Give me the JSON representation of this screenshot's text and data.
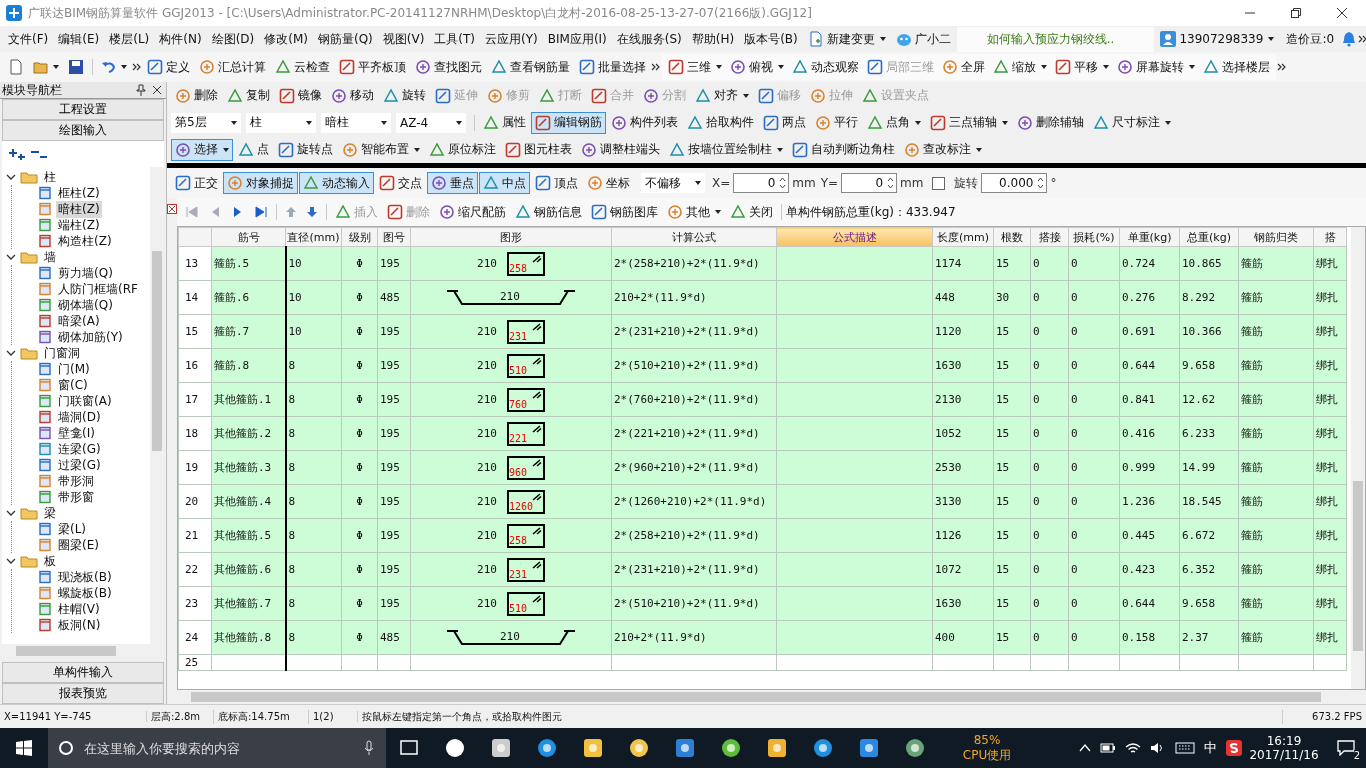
{
  "title_bar": {
    "title": "广联达BIM钢筋算量软件 GGJ2013 - [C:\\Users\\Administrator.PC-20141127NRHM\\Desktop\\白龙村-2016-08-25-13-27-07(2166版).GGJ12]"
  },
  "menu_bar": {
    "menus": [
      "文件(F)",
      "编辑(E)",
      "楼层(L)",
      "构件(N)",
      "绘图(D)",
      "修改(M)",
      "钢筋量(Q)",
      "视图(V)",
      "工具(T)",
      "云应用(Y)",
      "BIM应用(I)",
      "在线服务(S)",
      "帮助(H)",
      "版本号(B)"
    ],
    "new_change": "新建变更",
    "assistant": "广小二",
    "tip": "如何输入预应力钢绞线..",
    "account": "13907298339",
    "beans": "造价豆:0"
  },
  "main_toolbar": [
    {
      "label": "定义",
      "dropdown": false,
      "disabled": false
    },
    {
      "label": "汇总计算",
      "dropdown": false,
      "disabled": false
    },
    {
      "label": "云检查",
      "dropdown": false,
      "disabled": false
    },
    {
      "label": "平齐板顶",
      "dropdown": false,
      "disabled": false
    },
    {
      "label": "查找图元",
      "dropdown": false,
      "disabled": false
    },
    {
      "label": "查看钢筋量",
      "dropdown": false,
      "disabled": false
    },
    {
      "label": "批量选择",
      "dropdown": false,
      "disabled": false
    }
  ],
  "view_toolbar": [
    {
      "label": "三维",
      "dropdown": true,
      "disabled": false
    },
    {
      "label": "俯视",
      "dropdown": true,
      "disabled": false
    },
    {
      "label": "动态观察",
      "dropdown": false,
      "disabled": false
    },
    {
      "label": "局部三维",
      "dropdown": false,
      "disabled": true
    },
    {
      "label": "全屏",
      "dropdown": false,
      "disabled": false
    },
    {
      "label": "缩放",
      "dropdown": true,
      "disabled": false
    },
    {
      "label": "平移",
      "dropdown": true,
      "disabled": false
    },
    {
      "label": "屏幕旋转",
      "dropdown": true,
      "disabled": false
    },
    {
      "label": "选择楼层",
      "dropdown": false,
      "disabled": false
    }
  ],
  "navigator": {
    "title": "模块导航栏",
    "buttons": [
      "工程设置",
      "绘图输入"
    ],
    "bottom_buttons": [
      "单构件输入",
      "报表预览"
    ]
  },
  "tree": [
    {
      "label": "柱",
      "expanded": true,
      "selected": false,
      "children": [
        {
          "label": "框柱(Z)",
          "selected": false
        },
        {
          "label": "暗柱(Z)",
          "selected": true
        },
        {
          "label": "端柱(Z)",
          "selected": false
        },
        {
          "label": "构造柱(Z)",
          "selected": false
        }
      ]
    },
    {
      "label": "墙",
      "expanded": true,
      "selected": false,
      "children": [
        {
          "label": "剪力墙(Q)",
          "selected": false
        },
        {
          "label": "人防门框墙(RF",
          "selected": false
        },
        {
          "label": "砌体墙(Q)",
          "selected": false
        },
        {
          "label": "暗梁(A)",
          "selected": false
        },
        {
          "label": "砌体加筋(Y)",
          "selected": false
        }
      ]
    },
    {
      "label": "门窗洞",
      "expanded": true,
      "selected": false,
      "children": [
        {
          "label": "门(M)",
          "selected": false
        },
        {
          "label": "窗(C)",
          "selected": false
        },
        {
          "label": "门联窗(A)",
          "selected": false
        },
        {
          "label": "墙洞(D)",
          "selected": false
        },
        {
          "label": "壁龛(I)",
          "selected": false
        },
        {
          "label": "连梁(G)",
          "selected": false
        },
        {
          "label": "过梁(G)",
          "selected": false
        },
        {
          "label": "带形洞",
          "selected": false
        },
        {
          "label": "带形窗",
          "selected": false
        }
      ]
    },
    {
      "label": "梁",
      "expanded": true,
      "selected": false,
      "children": [
        {
          "label": "梁(L)",
          "selected": false
        },
        {
          "label": "圈梁(E)",
          "selected": false
        }
      ]
    },
    {
      "label": "板",
      "expanded": true,
      "selected": false,
      "children": [
        {
          "label": "现浇板(B)",
          "selected": false
        },
        {
          "label": "螺旋板(B)",
          "selected": false
        },
        {
          "label": "柱帽(V)",
          "selected": false
        },
        {
          "label": "板洞(N)",
          "selected": false
        }
      ]
    }
  ],
  "edit_toolbar": [
    {
      "label": "删除",
      "dropdown": false,
      "disabled": false
    },
    {
      "label": "复制",
      "dropdown": false,
      "disabled": false
    },
    {
      "label": "镜像",
      "dropdown": false,
      "disabled": false
    },
    {
      "label": "移动",
      "dropdown": false,
      "disabled": false
    },
    {
      "label": "旋转",
      "dropdown": false,
      "disabled": false
    },
    {
      "label": "延伸",
      "dropdown": false,
      "disabled": true
    },
    {
      "label": "修剪",
      "dropdown": false,
      "disabled": true
    },
    {
      "label": "打断",
      "dropdown": false,
      "disabled": true
    },
    {
      "label": "合并",
      "dropdown": false,
      "disabled": true
    },
    {
      "label": "分割",
      "dropdown": false,
      "disabled": true
    },
    {
      "label": "对齐",
      "dropdown": true,
      "disabled": false
    },
    {
      "label": "偏移",
      "dropdown": false,
      "disabled": true
    },
    {
      "label": "拉伸",
      "dropdown": false,
      "disabled": true
    },
    {
      "label": "设置夹点",
      "dropdown": false,
      "disabled": true
    }
  ],
  "component_bar": {
    "selectors": [
      "第5层",
      "柱",
      "暗柱",
      "AZ-4"
    ],
    "items": [
      {
        "label": "属性",
        "dropdown": false,
        "selected": false
      },
      {
        "label": "编辑钢筋",
        "dropdown": false,
        "selected": true
      },
      {
        "label": "构件列表",
        "dropdown": false,
        "selected": false
      },
      {
        "label": "拾取构件",
        "dropdown": false,
        "selected": false
      },
      {
        "label": "两点",
        "dropdown": false,
        "selected": false
      },
      {
        "label": "平行",
        "dropdown": false,
        "selected": false
      },
      {
        "label": "点角",
        "dropdown": true,
        "selected": false
      },
      {
        "label": "三点辅轴",
        "dropdown": true,
        "selected": false
      },
      {
        "label": "删除辅轴",
        "dropdown": false,
        "selected": false
      },
      {
        "label": "尺寸标注",
        "dropdown": true,
        "selected": false
      }
    ]
  },
  "draw_toolbar": [
    {
      "label": "选择",
      "dropdown": true,
      "selected": true
    },
    {
      "label": "点",
      "dropdown": false,
      "selected": false
    },
    {
      "label": "旋转点",
      "dropdown": false,
      "selected": false
    },
    {
      "label": "智能布置",
      "dropdown": true,
      "selected": false
    },
    {
      "label": "原位标注",
      "dropdown": false,
      "selected": false
    },
    {
      "label": "图元柱表",
      "dropdown": false,
      "selected": false
    },
    {
      "label": "调整柱端头",
      "dropdown": false,
      "selected": false
    },
    {
      "label": "按墙位置绘制柱",
      "dropdown": true,
      "selected": false
    },
    {
      "label": "自动判断边角柱",
      "dropdown": false,
      "selected": false
    },
    {
      "label": "查改标注",
      "dropdown": true,
      "selected": false
    }
  ],
  "snap_bar": {
    "items": [
      {
        "label": "正交",
        "selected": false
      },
      {
        "label": "对象捕捉",
        "selected": true
      },
      {
        "label": "动态输入",
        "selected": true
      },
      {
        "label": "交点",
        "selected": false
      },
      {
        "label": "垂点",
        "selected": true
      },
      {
        "label": "中点",
        "selected": true
      },
      {
        "label": "顶点",
        "selected": false
      },
      {
        "label": "坐标",
        "selected": false
      }
    ],
    "offset_mode": "不偏移",
    "x_label": "X=",
    "x_value": "0",
    "x_unit": "mm",
    "y_label": "Y=",
    "y_value": "0",
    "y_unit": "mm",
    "rotate_checked": false,
    "rotate_label": "旋转",
    "rotate_value": "0.000",
    "rotate_unit": "°"
  },
  "rebar_toolbar": {
    "items": [
      {
        "label": "插入",
        "dropdown": false,
        "disabled": true
      },
      {
        "label": "删除",
        "dropdown": false,
        "disabled": true
      },
      {
        "label": "缩尺配筋",
        "dropdown": false,
        "disabled": false
      },
      {
        "label": "钢筋信息",
        "dropdown": false,
        "disabled": false
      },
      {
        "label": "钢筋图库",
        "dropdown": false,
        "disabled": false
      },
      {
        "label": "其他",
        "dropdown": true,
        "disabled": false
      },
      {
        "label": "关闭",
        "dropdown": false,
        "disabled": false
      }
    ],
    "total": "单构件钢筋总重(kg)：433.947"
  },
  "table": {
    "columns": [
      "",
      "筋号",
      "直径(mm)",
      "级别",
      "图号",
      "图形",
      "计算公式",
      "公式描述",
      "长度(mm)",
      "根数",
      "搭接",
      "损耗(%)",
      "单重(kg)",
      "总重(kg)",
      "钢筋归类",
      "搭"
    ],
    "rows": [
      {
        "index": "13",
        "name": "箍筋.5",
        "diameter": "10",
        "grade": "Φ",
        "shape_no": "195",
        "shape": {
          "kind": "stirrup",
          "side": "210",
          "inner": "258"
        },
        "formula": "2*(258+210)+2*(11.9*d)",
        "length": "1174",
        "count": "15",
        "lap": "0",
        "loss": "0",
        "unit_weight": "0.724",
        "total_weight": "10.865",
        "category": "箍筋",
        "lap_type": "绑扎"
      },
      {
        "index": "14",
        "name": "箍筋.6",
        "diameter": "10",
        "grade": "Φ",
        "shape_no": "485",
        "shape": {
          "kind": "hooked-bar",
          "side": "210"
        },
        "formula": "210+2*(11.9*d)",
        "length": "448",
        "count": "30",
        "lap": "0",
        "loss": "0",
        "unit_weight": "0.276",
        "total_weight": "8.292",
        "category": "箍筋",
        "lap_type": "绑扎"
      },
      {
        "index": "15",
        "name": "箍筋.7",
        "diameter": "10",
        "grade": "Φ",
        "shape_no": "195",
        "shape": {
          "kind": "stirrup",
          "side": "210",
          "inner": "231"
        },
        "formula": "2*(231+210)+2*(11.9*d)",
        "length": "1120",
        "count": "15",
        "lap": "0",
        "loss": "0",
        "unit_weight": "0.691",
        "total_weight": "10.366",
        "category": "箍筋",
        "lap_type": "绑扎"
      },
      {
        "index": "16",
        "name": "箍筋.8",
        "diameter": "8",
        "grade": "Φ",
        "shape_no": "195",
        "shape": {
          "kind": "stirrup",
          "side": "210",
          "inner": "510"
        },
        "formula": "2*(510+210)+2*(11.9*d)",
        "length": "1630",
        "count": "15",
        "lap": "0",
        "loss": "0",
        "unit_weight": "0.644",
        "total_weight": "9.658",
        "category": "箍筋",
        "lap_type": "绑扎"
      },
      {
        "index": "17",
        "name": "其他箍筋.1",
        "diameter": "8",
        "grade": "Φ",
        "shape_no": "195",
        "shape": {
          "kind": "stirrup",
          "side": "210",
          "inner": "760"
        },
        "formula": "2*(760+210)+2*(11.9*d)",
        "length": "2130",
        "count": "15",
        "lap": "0",
        "loss": "0",
        "unit_weight": "0.841",
        "total_weight": "12.62",
        "category": "箍筋",
        "lap_type": "绑扎"
      },
      {
        "index": "18",
        "name": "其他箍筋.2",
        "diameter": "8",
        "grade": "Φ",
        "shape_no": "195",
        "shape": {
          "kind": "stirrup",
          "side": "210",
          "inner": "221"
        },
        "formula": "2*(221+210)+2*(11.9*d)",
        "length": "1052",
        "count": "15",
        "lap": "0",
        "loss": "0",
        "unit_weight": "0.416",
        "total_weight": "6.233",
        "category": "箍筋",
        "lap_type": "绑扎"
      },
      {
        "index": "19",
        "name": "其他箍筋.3",
        "diameter": "8",
        "grade": "Φ",
        "shape_no": "195",
        "shape": {
          "kind": "stirrup",
          "side": "210",
          "inner": "960"
        },
        "formula": "2*(960+210)+2*(11.9*d)",
        "length": "2530",
        "count": "15",
        "lap": "0",
        "loss": "0",
        "unit_weight": "0.999",
        "total_weight": "14.99",
        "category": "箍筋",
        "lap_type": "绑扎"
      },
      {
        "index": "20",
        "name": "其他箍筋.4",
        "diameter": "8",
        "grade": "Φ",
        "shape_no": "195",
        "shape": {
          "kind": "stirrup",
          "side": "210",
          "inner": "1260"
        },
        "formula": "2*(1260+210)+2*(11.9*d)",
        "length": "3130",
        "count": "15",
        "lap": "0",
        "loss": "0",
        "unit_weight": "1.236",
        "total_weight": "18.545",
        "category": "箍筋",
        "lap_type": "绑扎"
      },
      {
        "index": "21",
        "name": "其他箍筋.5",
        "diameter": "8",
        "grade": "Φ",
        "shape_no": "195",
        "shape": {
          "kind": "stirrup",
          "side": "210",
          "inner": "258"
        },
        "formula": "2*(258+210)+2*(11.9*d)",
        "length": "1126",
        "count": "15",
        "lap": "0",
        "loss": "0",
        "unit_weight": "0.445",
        "total_weight": "6.672",
        "category": "箍筋",
        "lap_type": "绑扎"
      },
      {
        "index": "22",
        "name": "其他箍筋.6",
        "diameter": "8",
        "grade": "Φ",
        "shape_no": "195",
        "shape": {
          "kind": "stirrup",
          "side": "210",
          "inner": "231"
        },
        "formula": "2*(231+210)+2*(11.9*d)",
        "length": "1072",
        "count": "15",
        "lap": "0",
        "loss": "0",
        "unit_weight": "0.423",
        "total_weight": "6.352",
        "category": "箍筋",
        "lap_type": "绑扎"
      },
      {
        "index": "23",
        "name": "其他箍筋.7",
        "diameter": "8",
        "grade": "Φ",
        "shape_no": "195",
        "shape": {
          "kind": "stirrup",
          "side": "210",
          "inner": "510"
        },
        "formula": "2*(510+210)+2*(11.9*d)",
        "length": "1630",
        "count": "15",
        "lap": "0",
        "loss": "0",
        "unit_weight": "0.644",
        "total_weight": "9.658",
        "category": "箍筋",
        "lap_type": "绑扎"
      },
      {
        "index": "24",
        "name": "其他箍筋.8",
        "diameter": "8",
        "grade": "Φ",
        "shape_no": "485",
        "shape": {
          "kind": "hooked-bar",
          "side": "210"
        },
        "formula": "210+2*(11.9*d)",
        "length": "400",
        "count": "15",
        "lap": "0",
        "loss": "0",
        "unit_weight": "0.158",
        "total_weight": "2.37",
        "category": "箍筋",
        "lap_type": "绑扎"
      },
      {
        "index": "25"
      }
    ]
  },
  "status_bar": [
    "X=11941 Y=-745",
    "层高:2.8m",
    "底标高:14.75m",
    "1(2)",
    "按鼠标左键指定第一个角点，或拾取构件图元",
    "673.2 FPS"
  ],
  "taskbar": {
    "search_placeholder": "在这里输入你要搜索的内容",
    "cpu_percent": "85%",
    "cpu_label": "CPU使用",
    "ime": "中",
    "time": "16:19",
    "date": "2017/11/16",
    "notifications": "2"
  }
}
